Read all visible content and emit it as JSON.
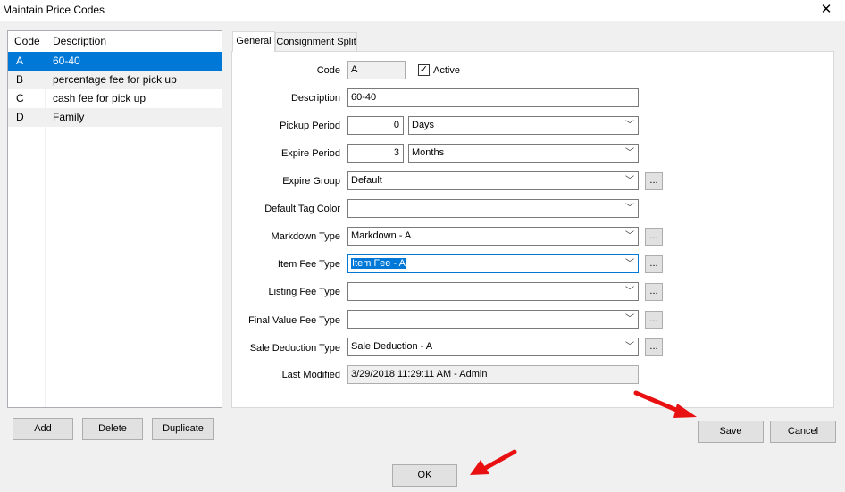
{
  "window": {
    "title": "Maintain Price Codes",
    "close_glyph": "✕"
  },
  "list": {
    "headers": {
      "code": "Code",
      "description": "Description"
    },
    "rows": [
      {
        "code": "A",
        "description": "60-40"
      },
      {
        "code": "B",
        "description": "percentage fee for pick up"
      },
      {
        "code": "C",
        "description": "cash fee for pick up"
      },
      {
        "code": "D",
        "description": "Family"
      }
    ],
    "selected_code": "A"
  },
  "tabs": [
    {
      "label": "General"
    },
    {
      "label": "Consignment Split"
    }
  ],
  "form": {
    "code_label": "Code",
    "code_value": "A",
    "active_label": "Active",
    "active_checked": true,
    "description_label": "Description",
    "description_value": "60-40",
    "pickup_period_label": "Pickup Period",
    "pickup_period_value": "0",
    "pickup_period_unit": "Days",
    "expire_period_label": "Expire Period",
    "expire_period_value": "3",
    "expire_period_unit": "Months",
    "expire_group_label": "Expire Group",
    "expire_group_value": "Default",
    "default_tag_color_label": "Default Tag Color",
    "default_tag_color_value": "",
    "markdown_type_label": "Markdown Type",
    "markdown_type_value": "Markdown - A",
    "item_fee_type_label": "Item Fee Type",
    "item_fee_type_value": "Item Fee - A",
    "listing_fee_type_label": "Listing Fee Type",
    "listing_fee_type_value": "",
    "final_value_fee_type_label": "Final Value Fee Type",
    "final_value_fee_type_value": "",
    "sale_deduction_type_label": "Sale Deduction Type",
    "sale_deduction_type_value": "Sale Deduction - A",
    "last_modified_label": "Last Modified",
    "last_modified_value": "3/29/2018 11:29:11 AM - Admin",
    "ellipsis": "..."
  },
  "buttons": {
    "add": "Add",
    "delete": "Delete",
    "duplicate": "Duplicate",
    "save": "Save",
    "cancel": "Cancel",
    "ok": "OK"
  },
  "colors": {
    "selection": "#0078d7",
    "arrow": "#e81010"
  }
}
